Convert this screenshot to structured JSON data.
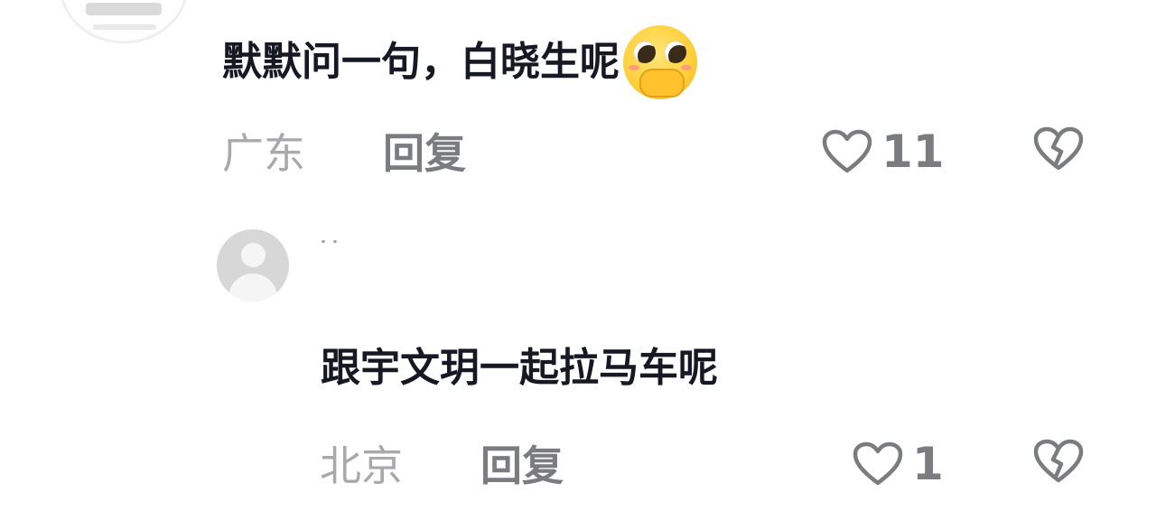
{
  "comments": [
    {
      "text": "默默问一句，白晓生呢",
      "emoji": "pleading-face-emoji",
      "location": "广东",
      "reply_label": "回复",
      "likes": "11"
    },
    {
      "username": "˙˙",
      "text": "跟宇文玥一起拉马车呢",
      "location": "北京",
      "reply_label": "回复",
      "likes": "1"
    }
  ],
  "icons": {
    "like": "heart-outline-icon",
    "dislike": "broken-heart-icon"
  },
  "colors": {
    "text_primary": "#161823",
    "text_location": "#a9a9ad",
    "text_secondary": "#7b7c80"
  }
}
